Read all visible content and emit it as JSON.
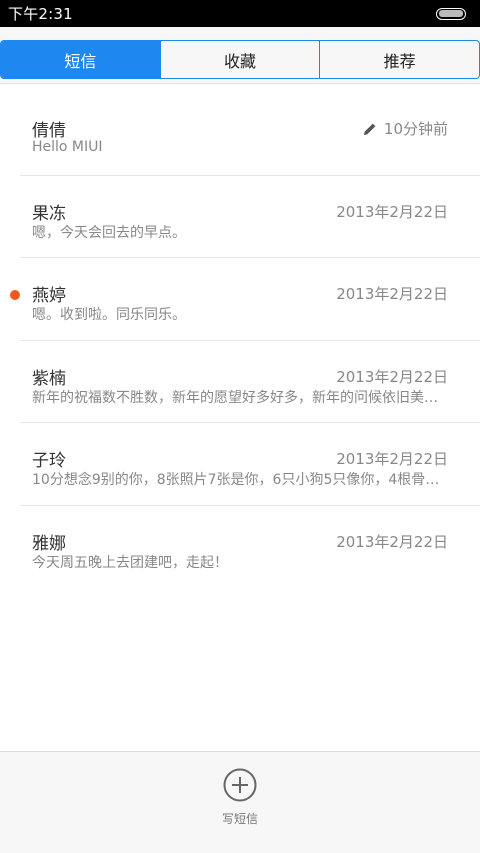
{
  "status_bar": {
    "time": "下午2:31"
  },
  "tabs": [
    {
      "label": "短信",
      "active": true
    },
    {
      "label": "收藏",
      "active": false
    },
    {
      "label": "推荐",
      "active": false
    }
  ],
  "messages": [
    {
      "name": "倩倩",
      "preview": "Hello MIUI",
      "date": "10分钟前",
      "draft": true,
      "unread": false
    },
    {
      "name": "果冻",
      "preview": "嗯，今天会回去的早点。",
      "date": "2013年2月22日",
      "draft": false,
      "unread": false
    },
    {
      "name": "燕婷",
      "preview": "嗯。收到啦。同乐同乐。",
      "date": "2013年2月22日",
      "draft": false,
      "unread": true
    },
    {
      "name": "紫楠",
      "preview": "新年的祝福数不胜数，新年的愿望好多好多，新年的问候依旧美好…",
      "date": "2013年2月22日",
      "draft": false,
      "unread": false
    },
    {
      "name": "子玲",
      "preview": "10分想念9别的你，8张照片7张是你，6只小狗5只像你，4根骨头…",
      "date": "2013年2月22日",
      "draft": false,
      "unread": false
    },
    {
      "name": "雅娜",
      "preview": "今天周五晚上去团建吧，走起！",
      "date": "2013年2月22日",
      "draft": false,
      "unread": false
    }
  ],
  "footer": {
    "compose_label": "写短信",
    "icon": "plus-circle-icon"
  },
  "colors": {
    "accent": "#1e88f0",
    "unread": "#f15a1d"
  }
}
